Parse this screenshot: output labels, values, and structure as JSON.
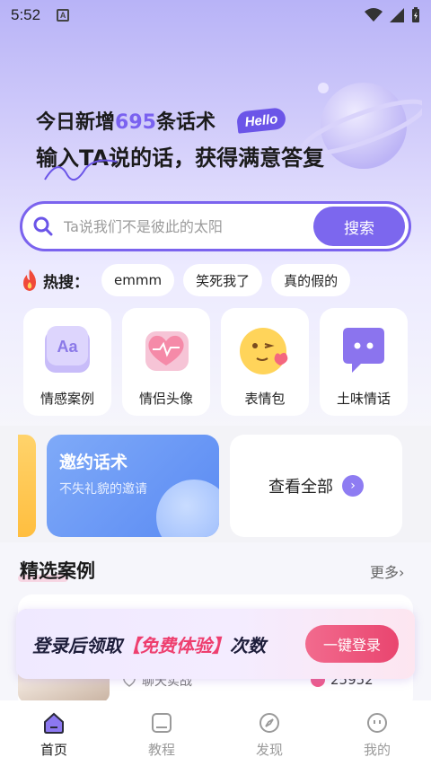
{
  "status_bar": {
    "time": "5:52",
    "a_icon": "A"
  },
  "hero": {
    "line1_prefix": "今日新增",
    "line1_number": "695",
    "line1_suffix": "条话术",
    "badge": "Hello",
    "line2": "输入TA说的话，获得满意答复"
  },
  "search": {
    "placeholder": "Ta说我们不是彼此的太阳",
    "button_label": "搜索"
  },
  "hot_search": {
    "label": "热搜：",
    "chips": [
      "emmm",
      "笑死我了",
      "真的假的"
    ]
  },
  "categories": [
    {
      "label": "情感案例",
      "icon": "aa-icon"
    },
    {
      "label": "情侣头像",
      "icon": "heart-icon"
    },
    {
      "label": "表情包",
      "icon": "emoji-icon"
    },
    {
      "label": "土味情话",
      "icon": "chat-bubble-icon"
    }
  ],
  "invite_card": {
    "title": "邀约话术",
    "subtitle": "不失礼貌的邀请"
  },
  "view_all": {
    "label": "查看全部",
    "arrow": "›"
  },
  "featured": {
    "title": "精选案例",
    "more": "更多›"
  },
  "case": {
    "tag": "聊天实战",
    "count": "25952"
  },
  "login_banner": {
    "text_prefix": "登录后领取",
    "text_highlight": "【免费体验】",
    "text_suffix": "次数",
    "button_label": "一键登录"
  },
  "nav": [
    {
      "label": "首页",
      "active": true
    },
    {
      "label": "教程",
      "active": false
    },
    {
      "label": "发现",
      "active": false
    },
    {
      "label": "我的",
      "active": false
    }
  ],
  "colors": {
    "accent": "#7c67ee",
    "highlight": "#ee3f6f",
    "brand_light": "#b8b3f7"
  }
}
